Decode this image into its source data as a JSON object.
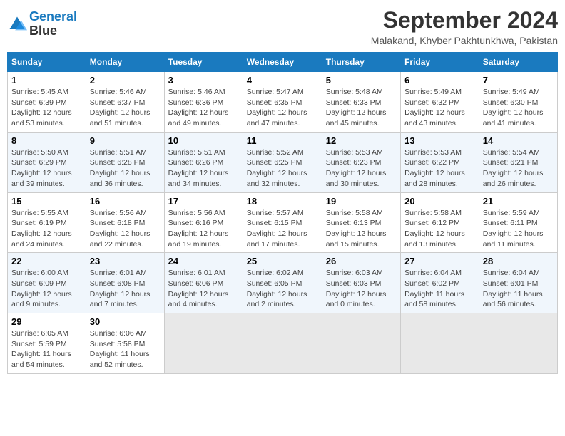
{
  "header": {
    "logo_line1": "General",
    "logo_line2": "Blue",
    "month": "September 2024",
    "location": "Malakand, Khyber Pakhtunkhwa, Pakistan"
  },
  "weekdays": [
    "Sunday",
    "Monday",
    "Tuesday",
    "Wednesday",
    "Thursday",
    "Friday",
    "Saturday"
  ],
  "weeks": [
    [
      {
        "day": "1",
        "sunrise": "5:45 AM",
        "sunset": "6:39 PM",
        "daylight": "12 hours and 53 minutes."
      },
      {
        "day": "2",
        "sunrise": "5:46 AM",
        "sunset": "6:37 PM",
        "daylight": "12 hours and 51 minutes."
      },
      {
        "day": "3",
        "sunrise": "5:46 AM",
        "sunset": "6:36 PM",
        "daylight": "12 hours and 49 minutes."
      },
      {
        "day": "4",
        "sunrise": "5:47 AM",
        "sunset": "6:35 PM",
        "daylight": "12 hours and 47 minutes."
      },
      {
        "day": "5",
        "sunrise": "5:48 AM",
        "sunset": "6:33 PM",
        "daylight": "12 hours and 45 minutes."
      },
      {
        "day": "6",
        "sunrise": "5:49 AM",
        "sunset": "6:32 PM",
        "daylight": "12 hours and 43 minutes."
      },
      {
        "day": "7",
        "sunrise": "5:49 AM",
        "sunset": "6:30 PM",
        "daylight": "12 hours and 41 minutes."
      }
    ],
    [
      {
        "day": "8",
        "sunrise": "5:50 AM",
        "sunset": "6:29 PM",
        "daylight": "12 hours and 39 minutes."
      },
      {
        "day": "9",
        "sunrise": "5:51 AM",
        "sunset": "6:28 PM",
        "daylight": "12 hours and 36 minutes."
      },
      {
        "day": "10",
        "sunrise": "5:51 AM",
        "sunset": "6:26 PM",
        "daylight": "12 hours and 34 minutes."
      },
      {
        "day": "11",
        "sunrise": "5:52 AM",
        "sunset": "6:25 PM",
        "daylight": "12 hours and 32 minutes."
      },
      {
        "day": "12",
        "sunrise": "5:53 AM",
        "sunset": "6:23 PM",
        "daylight": "12 hours and 30 minutes."
      },
      {
        "day": "13",
        "sunrise": "5:53 AM",
        "sunset": "6:22 PM",
        "daylight": "12 hours and 28 minutes."
      },
      {
        "day": "14",
        "sunrise": "5:54 AM",
        "sunset": "6:21 PM",
        "daylight": "12 hours and 26 minutes."
      }
    ],
    [
      {
        "day": "15",
        "sunrise": "5:55 AM",
        "sunset": "6:19 PM",
        "daylight": "12 hours and 24 minutes."
      },
      {
        "day": "16",
        "sunrise": "5:56 AM",
        "sunset": "6:18 PM",
        "daylight": "12 hours and 22 minutes."
      },
      {
        "day": "17",
        "sunrise": "5:56 AM",
        "sunset": "6:16 PM",
        "daylight": "12 hours and 19 minutes."
      },
      {
        "day": "18",
        "sunrise": "5:57 AM",
        "sunset": "6:15 PM",
        "daylight": "12 hours and 17 minutes."
      },
      {
        "day": "19",
        "sunrise": "5:58 AM",
        "sunset": "6:13 PM",
        "daylight": "12 hours and 15 minutes."
      },
      {
        "day": "20",
        "sunrise": "5:58 AM",
        "sunset": "6:12 PM",
        "daylight": "12 hours and 13 minutes."
      },
      {
        "day": "21",
        "sunrise": "5:59 AM",
        "sunset": "6:11 PM",
        "daylight": "12 hours and 11 minutes."
      }
    ],
    [
      {
        "day": "22",
        "sunrise": "6:00 AM",
        "sunset": "6:09 PM",
        "daylight": "12 hours and 9 minutes."
      },
      {
        "day": "23",
        "sunrise": "6:01 AM",
        "sunset": "6:08 PM",
        "daylight": "12 hours and 7 minutes."
      },
      {
        "day": "24",
        "sunrise": "6:01 AM",
        "sunset": "6:06 PM",
        "daylight": "12 hours and 4 minutes."
      },
      {
        "day": "25",
        "sunrise": "6:02 AM",
        "sunset": "6:05 PM",
        "daylight": "12 hours and 2 minutes."
      },
      {
        "day": "26",
        "sunrise": "6:03 AM",
        "sunset": "6:03 PM",
        "daylight": "12 hours and 0 minutes."
      },
      {
        "day": "27",
        "sunrise": "6:04 AM",
        "sunset": "6:02 PM",
        "daylight": "11 hours and 58 minutes."
      },
      {
        "day": "28",
        "sunrise": "6:04 AM",
        "sunset": "6:01 PM",
        "daylight": "11 hours and 56 minutes."
      }
    ],
    [
      {
        "day": "29",
        "sunrise": "6:05 AM",
        "sunset": "5:59 PM",
        "daylight": "11 hours and 54 minutes."
      },
      {
        "day": "30",
        "sunrise": "6:06 AM",
        "sunset": "5:58 PM",
        "daylight": "11 hours and 52 minutes."
      },
      null,
      null,
      null,
      null,
      null
    ]
  ]
}
